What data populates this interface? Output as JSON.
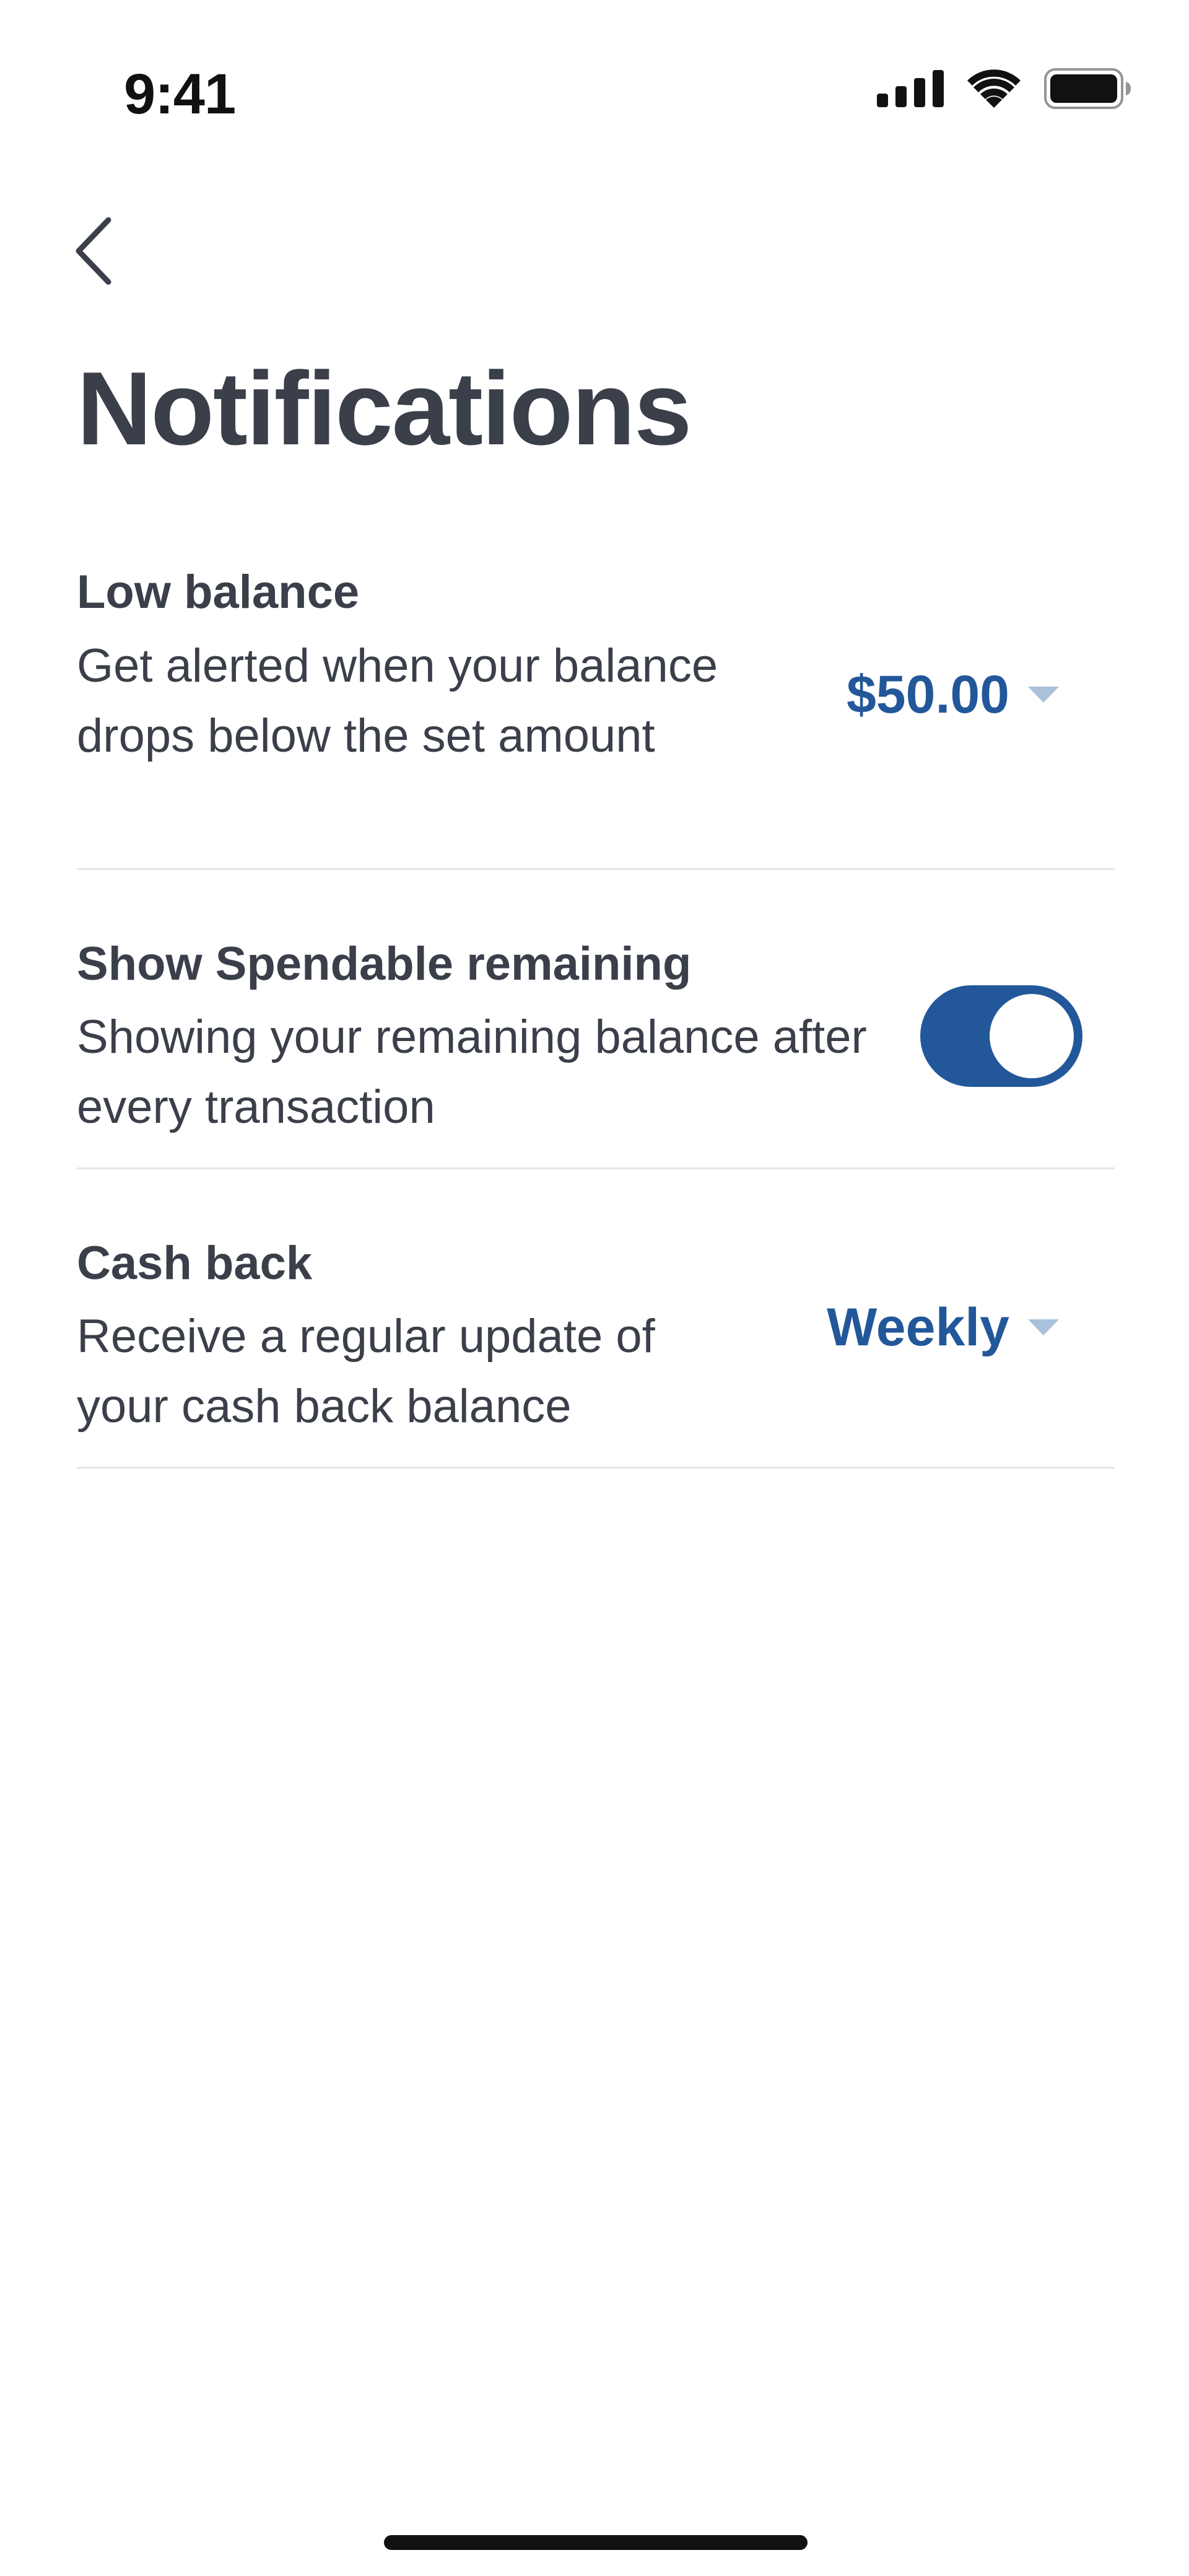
{
  "status_bar": {
    "time": "9:41"
  },
  "header": {
    "back_icon": "chevron-left-icon",
    "title": "Notifications"
  },
  "settings": {
    "low_balance": {
      "title": "Low balance",
      "description": "Get alerted when your balance drops below the set amount",
      "value": "$50.00"
    },
    "spendable": {
      "title": "Show Spendable remaining",
      "description": "Showing your remaining balance after every transaction",
      "enabled": true
    },
    "cash_back": {
      "title": "Cash back",
      "description": "Receive a regular update of your cash back balance",
      "value": "Weekly"
    }
  },
  "colors": {
    "accent": "#22589a",
    "text": "#3a3f4a",
    "divider": "#e3e5e8",
    "caret": "#a9c1d9"
  }
}
